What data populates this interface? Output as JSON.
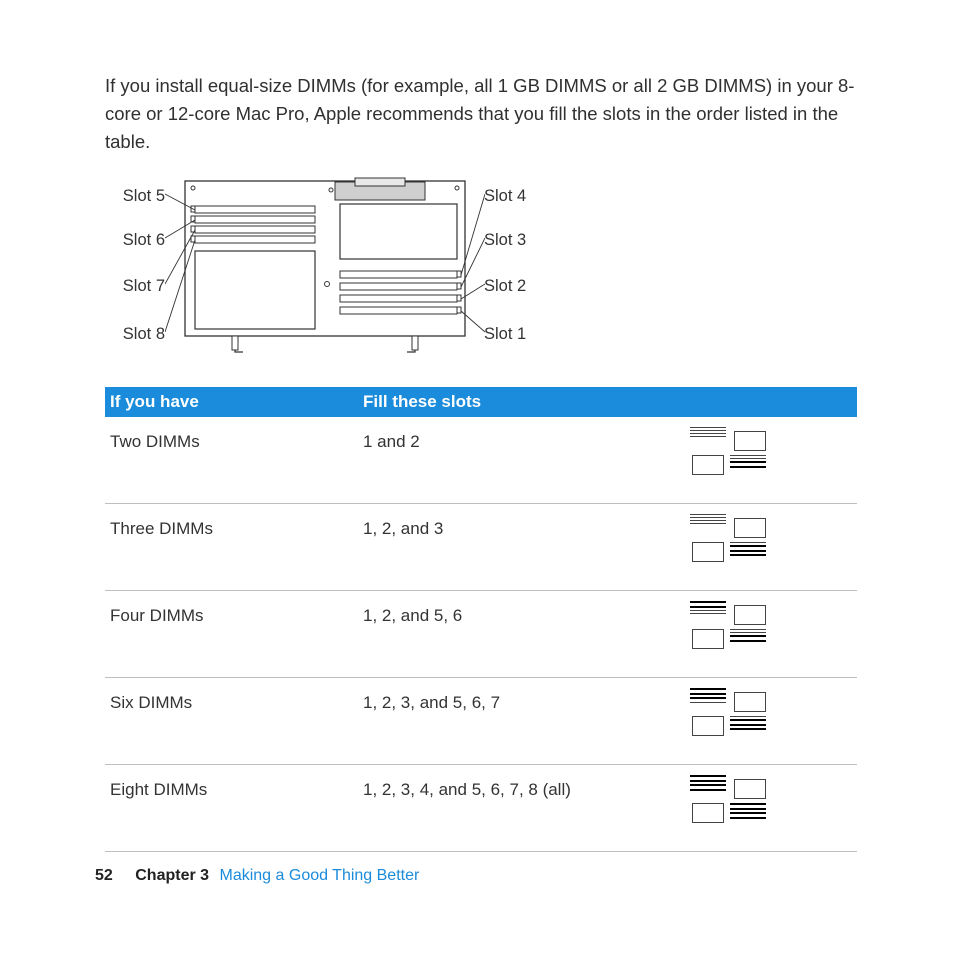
{
  "intro_text": "If you install equal-size DIMMs (for example, all 1 GB DIMMS or all 2 GB DIMMS) in your 8-core or 12-core Mac Pro, Apple recommends that you fill the slots in the order listed in the table.",
  "diagram": {
    "left": [
      "Slot 5",
      "Slot 6",
      "Slot 7",
      "Slot 8"
    ],
    "right": [
      "Slot 4",
      "Slot 3",
      "Slot 2",
      "Slot 1"
    ]
  },
  "table": {
    "header": {
      "col1": "If you have",
      "col2": "Fill these slots"
    },
    "rows": [
      {
        "have": "Two DIMMs",
        "fill": "1 and 2",
        "slots": [
          1,
          2
        ]
      },
      {
        "have": "Three DIMMs",
        "fill": "1, 2, and 3",
        "slots": [
          1,
          2,
          3
        ]
      },
      {
        "have": "Four DIMMs",
        "fill": "1, 2, and 5, 6",
        "slots": [
          1,
          2,
          5,
          6
        ]
      },
      {
        "have": "Six DIMMs",
        "fill": "1, 2, 3, and 5, 6, 7",
        "slots": [
          1,
          2,
          3,
          5,
          6,
          7
        ]
      },
      {
        "have": "Eight DIMMs",
        "fill": "1, 2, 3, 4, and 5, 6, 7, 8 (all)",
        "slots": [
          1,
          2,
          3,
          4,
          5,
          6,
          7,
          8
        ]
      }
    ]
  },
  "footer": {
    "page_number": "52",
    "chapter_label": "Chapter 3",
    "chapter_title": "Making a Good Thing Better"
  }
}
